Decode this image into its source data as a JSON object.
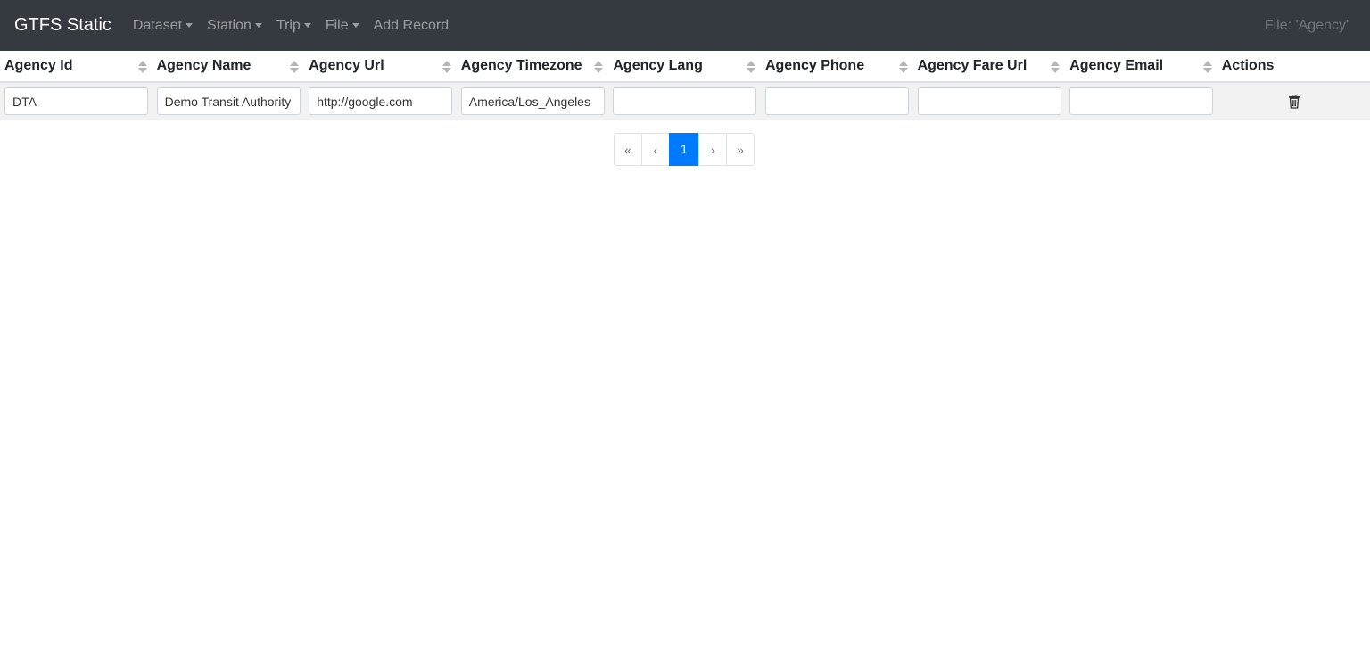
{
  "navbar": {
    "brand": "GTFS Static",
    "items": [
      {
        "label": "Dataset",
        "dropdown": true
      },
      {
        "label": "Station",
        "dropdown": true
      },
      {
        "label": "Trip",
        "dropdown": true
      },
      {
        "label": "File",
        "dropdown": true
      },
      {
        "label": "Add Record",
        "dropdown": false
      }
    ],
    "file_label": "File: 'Agency'"
  },
  "table": {
    "columns": [
      "Agency Id",
      "Agency Name",
      "Agency Url",
      "Agency Timezone",
      "Agency Lang",
      "Agency Phone",
      "Agency Fare Url",
      "Agency Email",
      "Actions"
    ],
    "rows": [
      {
        "values": [
          "DTA",
          "Demo Transit Authority",
          "http://google.com",
          "America/Los_Angeles",
          "",
          "",
          "",
          ""
        ],
        "action_icon": "trash-icon"
      }
    ]
  },
  "pagination": {
    "first": "«",
    "prev": "‹",
    "current": "1",
    "next": "›",
    "last": "»"
  },
  "colors": {
    "navbar_bg": "#343a40",
    "active_page": "#007bff",
    "row_bg": "#f2f2f2"
  }
}
